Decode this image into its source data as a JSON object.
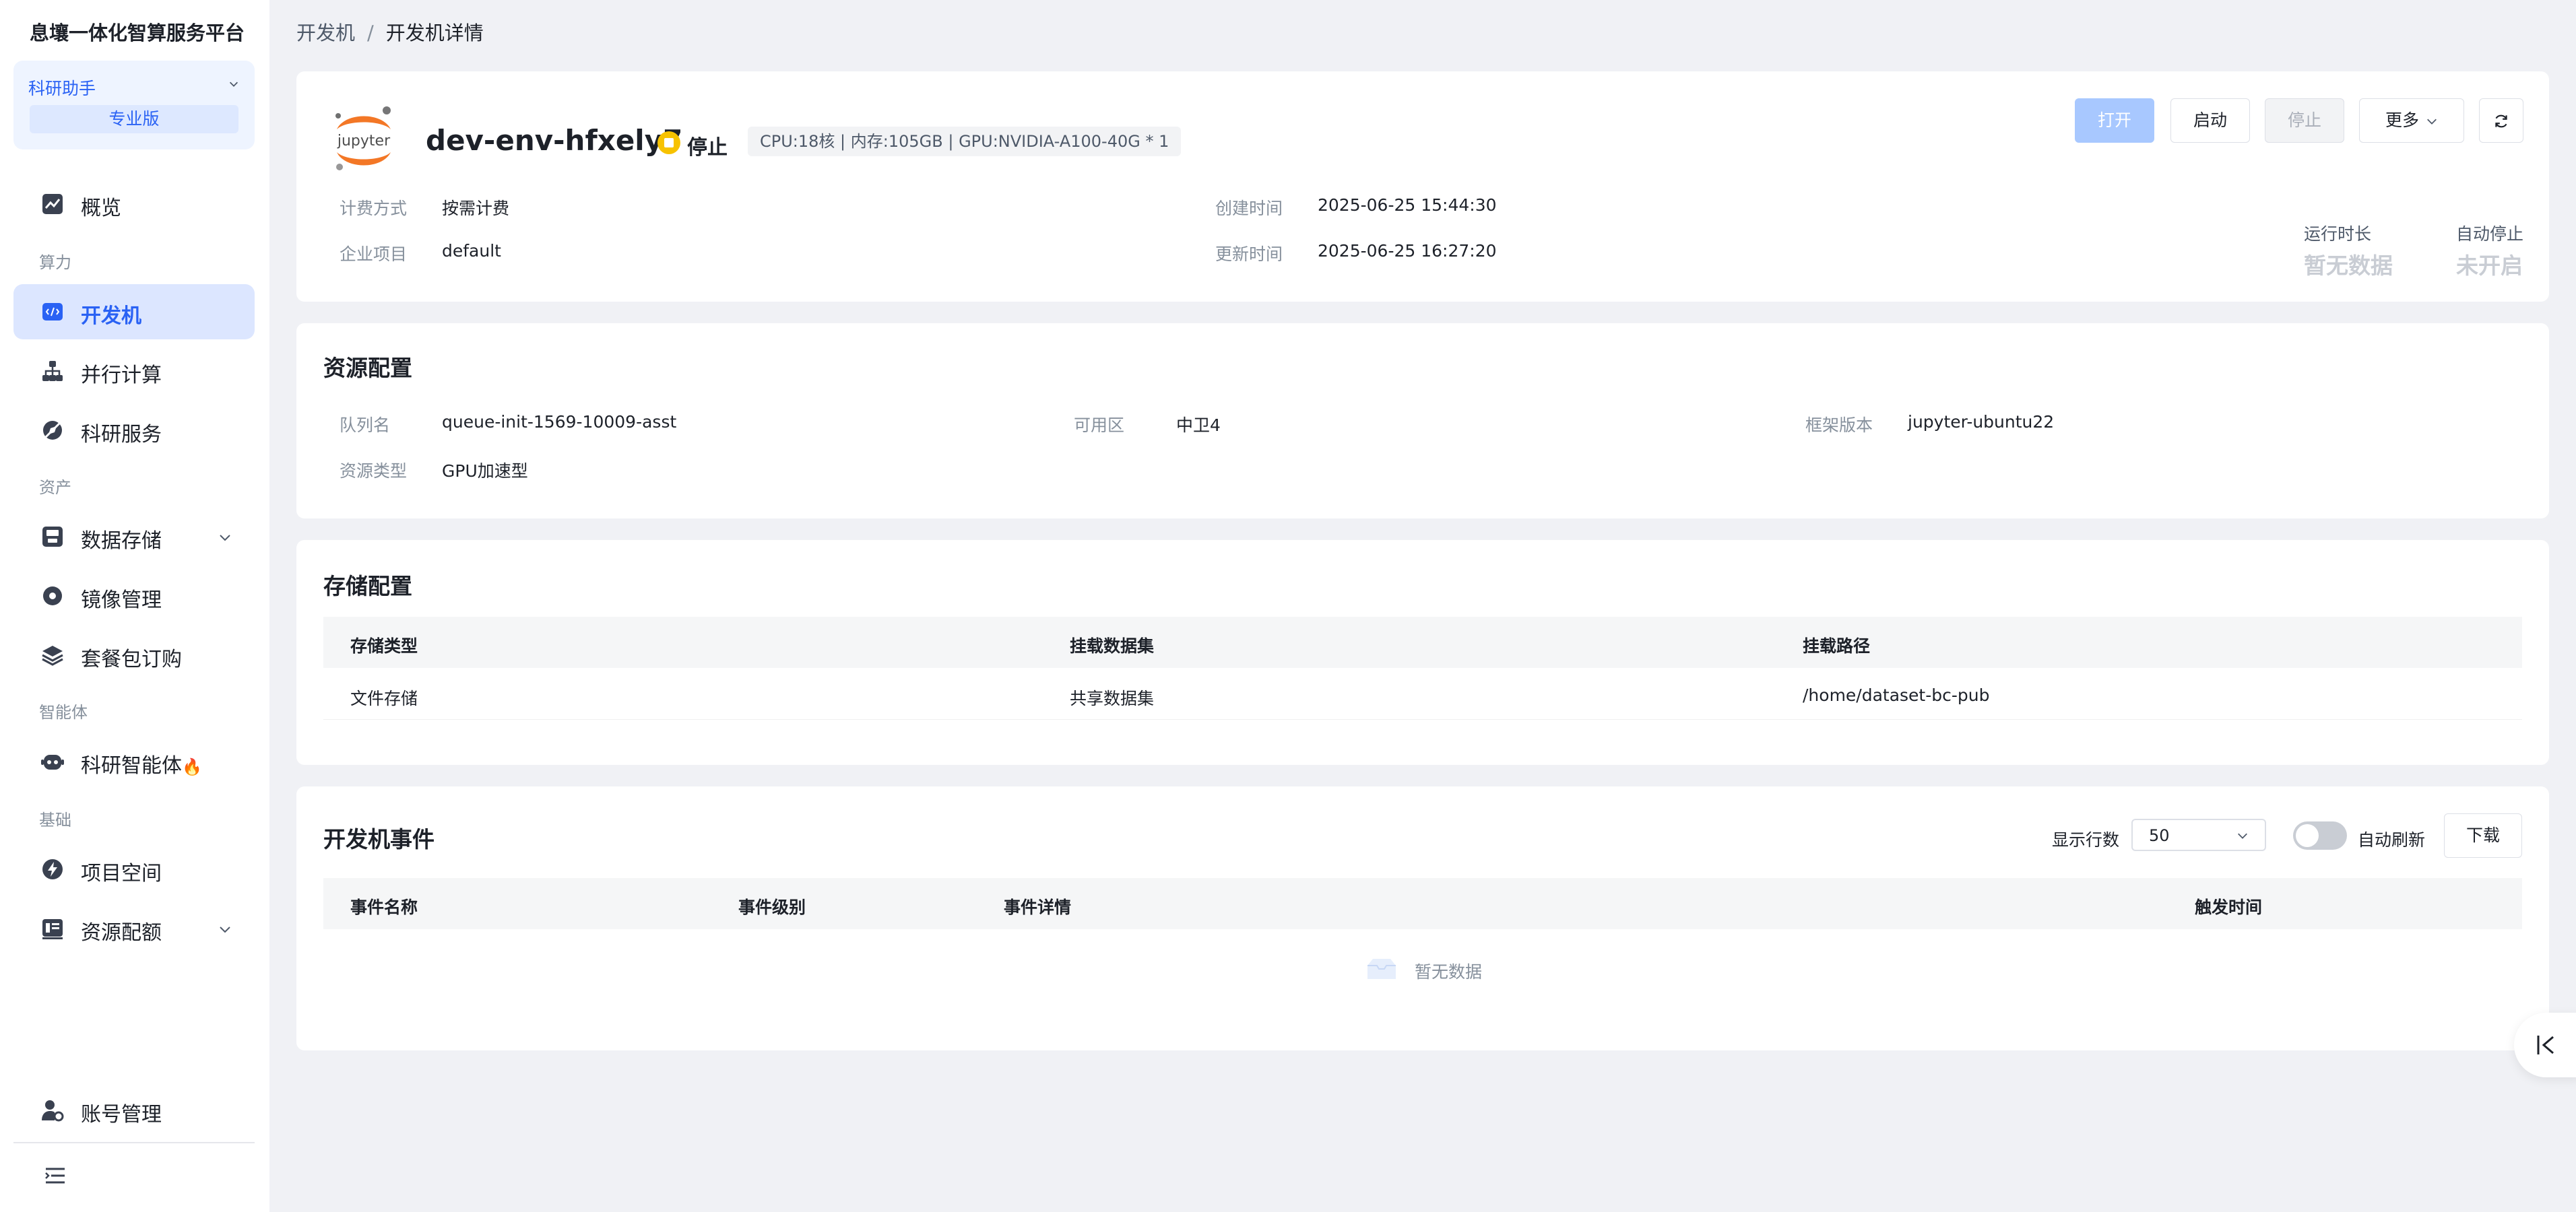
{
  "sidebar": {
    "brand": "息壤一体化智算服务平台",
    "role": {
      "name": "科研助手",
      "edition": "专业版"
    },
    "sections": {
      "compute": "算力",
      "assets": "资产",
      "agents": "智能体",
      "basic": "基础"
    },
    "items": [
      {
        "label": "概览",
        "icon": "overview-chart-icon"
      },
      {
        "label": "开发机",
        "icon": "code-terminal-icon",
        "active": true
      },
      {
        "label": "并行计算",
        "icon": "hierarchy-icon"
      },
      {
        "label": "科研服务",
        "icon": "compass-icon"
      },
      {
        "label": "数据存储",
        "icon": "storage-icon",
        "expandable": true
      },
      {
        "label": "镜像管理",
        "icon": "disc-icon"
      },
      {
        "label": "套餐包订购",
        "icon": "layers-icon"
      },
      {
        "label": "科研智能体",
        "icon": "robot-icon",
        "badge": "🔥"
      },
      {
        "label": "项目空间",
        "icon": "lightning-icon"
      },
      {
        "label": "资源配额",
        "icon": "quota-icon",
        "expandable": true
      },
      {
        "label": "账号管理",
        "icon": "user-gear-icon"
      }
    ]
  },
  "breadcrumb": {
    "parent": "开发机",
    "sep": "/",
    "current": "开发机详情"
  },
  "header": {
    "logo_text": "jupyter",
    "name": "dev-env-hfxely7",
    "status": "停止",
    "status_color": "#f7c200",
    "spec": "CPU:18核 | 内存:105GB | GPU:NVIDIA-A100-40G * 1",
    "fields": {
      "billing_label": "计费方式",
      "billing_value": "按需计费",
      "project_label": "企业项目",
      "project_value": "default",
      "created_label": "创建时间",
      "created_value": "2025-06-25 15:44:30",
      "updated_label": "更新时间",
      "updated_value": "2025-06-25 16:27:20"
    },
    "buttons": {
      "open": "打开",
      "start": "启动",
      "stop": "停止",
      "more": "更多"
    },
    "metrics": {
      "runtime_label": "运行时长",
      "runtime_value": "暂无数据",
      "autostop_label": "自动停止",
      "autostop_value": "未开启"
    }
  },
  "resource": {
    "title": "资源配置",
    "queue_label": "队列名",
    "queue_value": "queue-init-1569-10009-asst",
    "zone_label": "可用区",
    "zone_value": "中卫4",
    "framework_label": "框架版本",
    "framework_value": "jupyter-ubuntu22",
    "type_label": "资源类型",
    "type_value": "GPU加速型"
  },
  "storage": {
    "title": "存储配置",
    "columns": [
      "存储类型",
      "挂载数据集",
      "挂载路径"
    ],
    "rows": [
      [
        "文件存储",
        "共享数据集",
        "/home/dataset-bc-pub"
      ]
    ]
  },
  "events": {
    "title": "开发机事件",
    "rows_label": "显示行数",
    "rows_value": "50",
    "auto_refresh_label": "自动刷新",
    "auto_refresh_on": false,
    "download": "下载",
    "columns": [
      "事件名称",
      "事件级别",
      "事件详情",
      "触发时间"
    ],
    "empty_text": "暂无数据"
  },
  "colors": {
    "accent": "#2a62f4",
    "status_stopped": "#f7c200"
  }
}
